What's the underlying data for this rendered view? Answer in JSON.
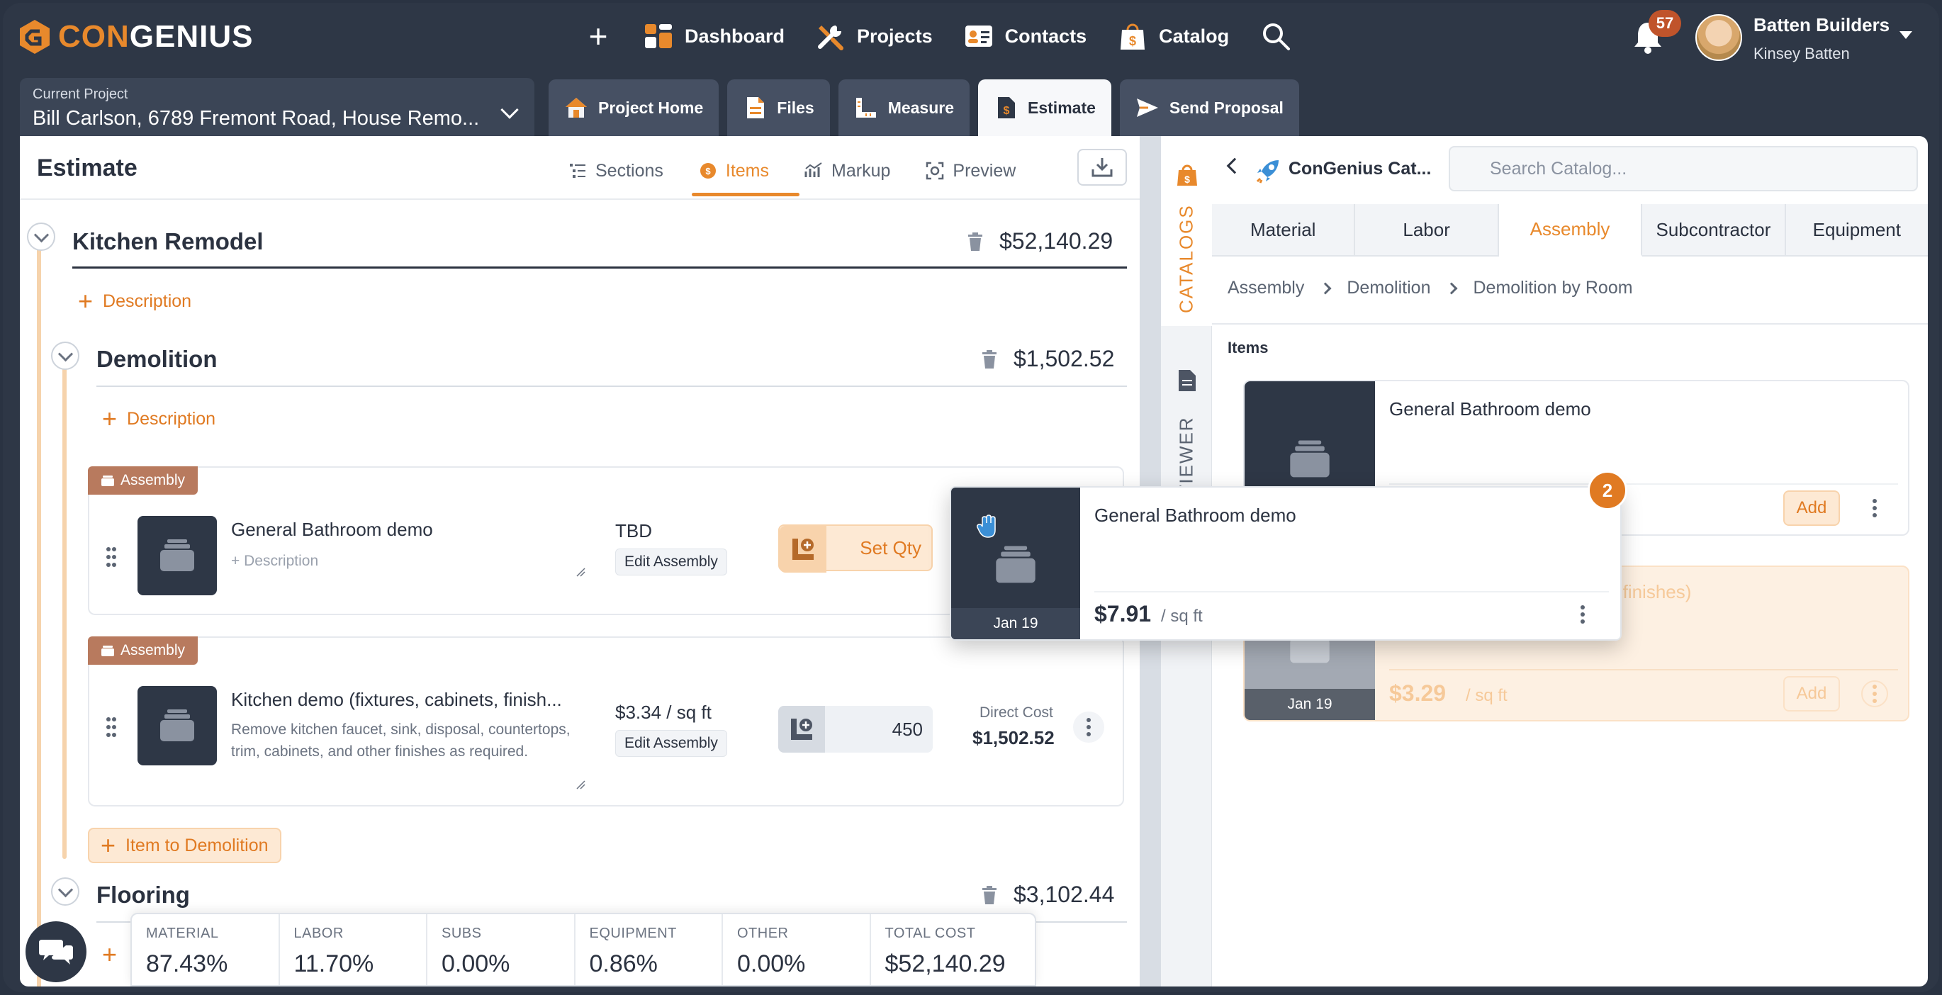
{
  "app": {
    "logo_pre": "CON",
    "logo_post": "GENIUS",
    "nav": [
      {
        "label": "Dashboard",
        "icon": "dashboard-icon"
      },
      {
        "label": "Projects",
        "icon": "tools-icon"
      },
      {
        "label": "Contacts",
        "icon": "contact-card-icon"
      },
      {
        "label": "Catalog",
        "icon": "catalog-bag-icon"
      }
    ],
    "notifications": "57",
    "user": {
      "company": "Batten Builders",
      "name": "Kinsey Batten"
    }
  },
  "project": {
    "label": "Current Project",
    "name": "Bill Carlson, 6789 Fremont Road, House Remo..."
  },
  "tabs": [
    {
      "label": "Project Home",
      "icon": "home-icon"
    },
    {
      "label": "Files",
      "icon": "file-icon"
    },
    {
      "label": "Measure",
      "icon": "ruler-icon"
    },
    {
      "label": "Estimate",
      "icon": "estimate-icon",
      "active": true
    },
    {
      "label": "Send Proposal",
      "icon": "send-icon"
    }
  ],
  "estimate": {
    "title": "Estimate",
    "tabs": [
      {
        "label": "Sections"
      },
      {
        "label": "Items",
        "active": true
      },
      {
        "label": "Markup"
      },
      {
        "label": "Preview"
      }
    ],
    "sections": {
      "kitchen": {
        "title": "Kitchen Remodel",
        "total": "$52,140.29",
        "add_desc": "Description"
      },
      "demolition": {
        "title": "Demolition",
        "total": "$1,502.52",
        "add_desc": "Description"
      },
      "flooring": {
        "title": "Flooring",
        "total": "$3,102.44"
      }
    },
    "items": [
      {
        "tag": "Assembly",
        "name": "General Bathroom demo",
        "description_placeholder": "+ Description",
        "price": "TBD",
        "edit": "Edit Assembly",
        "qty": "Set Qty"
      },
      {
        "tag": "Assembly",
        "name": "Kitchen demo (fixtures, cabinets, finish...",
        "description": "Remove kitchen faucet, sink, disposal, countertops, trim, cabinets, and other finishes as required.",
        "price": "$3.34 / sq ft",
        "edit": "Edit Assembly",
        "qty": "450",
        "direct_cost_label": "Direct Cost",
        "direct_cost": "$1,502.52"
      }
    ],
    "add_item": "Item to Demolition",
    "totals": [
      {
        "label": "MATERIAL",
        "value": "87.43%"
      },
      {
        "label": "LABOR",
        "value": "11.70%"
      },
      {
        "label": "SUBS",
        "value": "0.00%"
      },
      {
        "label": "EQUIPMENT",
        "value": "0.86%"
      },
      {
        "label": "OTHER",
        "value": "0.00%"
      },
      {
        "label": "TOTAL COST",
        "value": "$52,140.29"
      }
    ]
  },
  "rail": {
    "catalogs": "CATALOGS",
    "viewer": "VIEWER"
  },
  "catalog": {
    "title": "ConGenius Cat...",
    "search_placeholder": "Search Catalog...",
    "tabs": [
      {
        "label": "Material"
      },
      {
        "label": "Labor"
      },
      {
        "label": "Assembly",
        "active": true
      },
      {
        "label": "Subcontractor"
      },
      {
        "label": "Equipment"
      }
    ],
    "breadcrumb": [
      "Assembly",
      "Demolition",
      "Demolition by Room"
    ],
    "items_label": "Items",
    "cards": [
      {
        "name": "General Bathroom demo",
        "add": "Add"
      },
      {
        "name": "nets, finishes)",
        "date": "Jan 19",
        "price": "$3.29",
        "unit": "/ sq ft",
        "add": "Add"
      }
    ]
  },
  "drag": {
    "name": "General Bathroom demo",
    "date": "Jan 19",
    "price": "$7.91",
    "unit": "/ sq ft",
    "count": "2"
  },
  "colors": {
    "accent": "#e8892c",
    "navy": "#2e3746",
    "assembly_tag": "#b87a5e"
  }
}
